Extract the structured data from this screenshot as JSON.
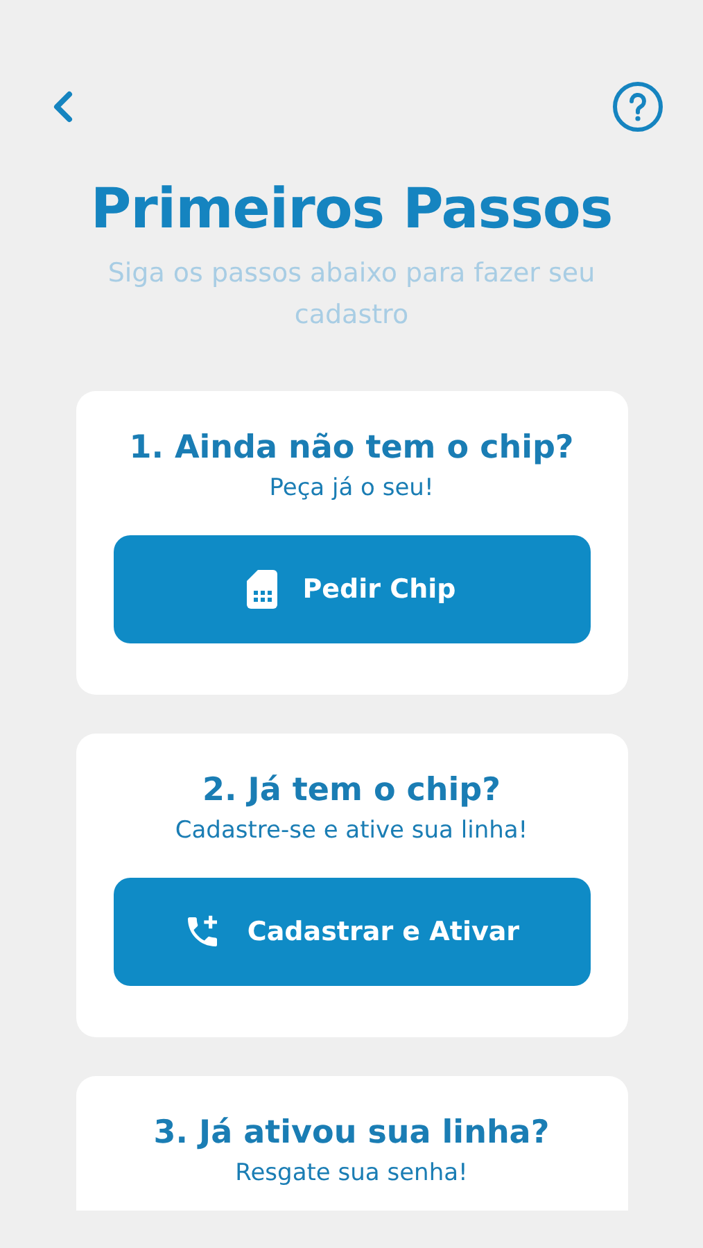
{
  "header": {
    "title": "Primeiros Passos",
    "subtitle": "Siga os passos abaixo para fazer seu cadastro"
  },
  "steps": [
    {
      "title": "1. Ainda não tem o chip?",
      "subtitle": "Peça já o seu!",
      "button": {
        "label": "Pedir Chip",
        "kind": "sim"
      }
    },
    {
      "title": "2. Já tem o chip?",
      "subtitle": "Cadastre-se e ative sua linha!",
      "button": {
        "label": "Cadastrar e Ativar",
        "kind": "phone-add"
      }
    },
    {
      "title": "3. Já ativou sua linha?",
      "subtitle": "Resgate sua senha!"
    }
  ]
}
